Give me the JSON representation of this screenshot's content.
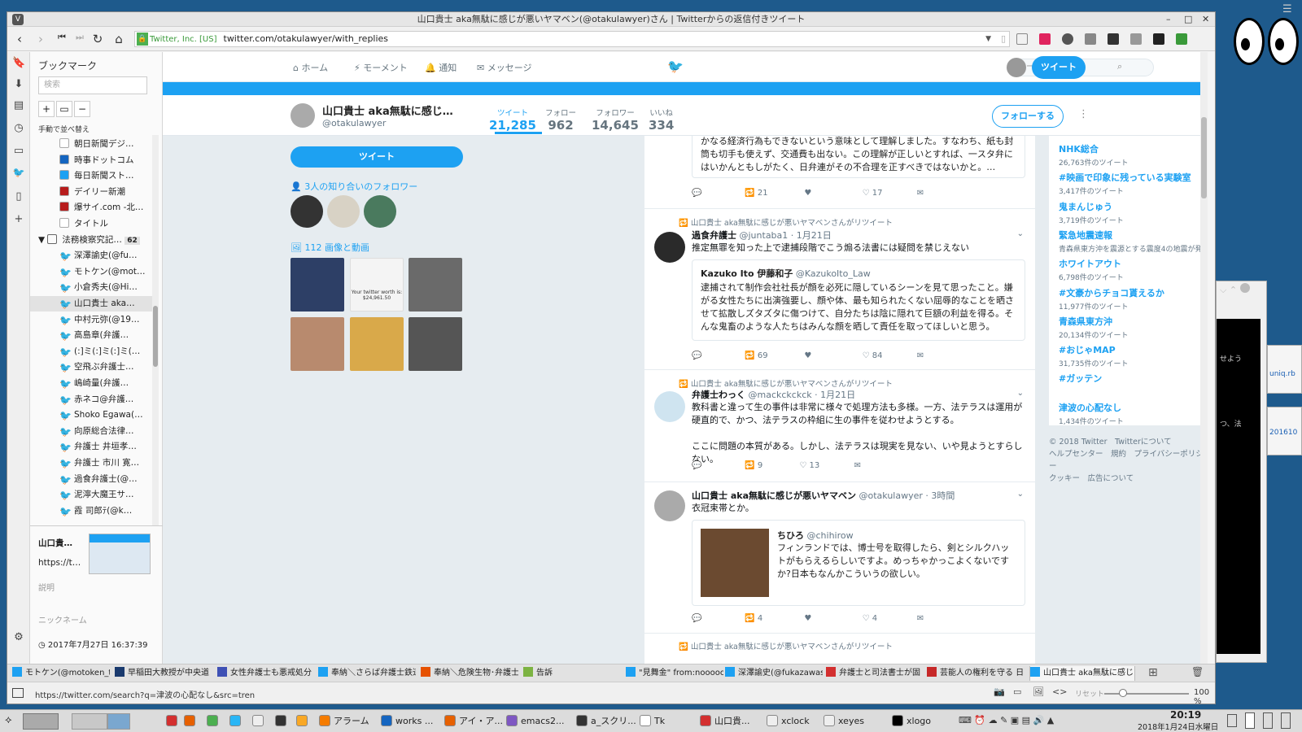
{
  "window": {
    "title": "山口貴士 aka無駄に感じが悪いヤマベン(@otakulawyer)さん | Twitterからの返信付きツイート"
  },
  "address": {
    "org": "Twitter, Inc. [US]",
    "url": "twitter.com/otakulawyer/with_replies"
  },
  "bookmarks": {
    "title": "ブックマーク",
    "search_placeholder": "検索",
    "sort_label": "手動で並べ替え",
    "items": [
      {
        "label": "朝日新聞デジ…",
        "icon": "page-icon"
      },
      {
        "label": "時事ドットコム",
        "icon": "globe-icon"
      },
      {
        "label": "毎日新聞スト…",
        "icon": "twitter-bird-icon"
      },
      {
        "label": "デイリー新潮",
        "icon": "site-icon"
      },
      {
        "label": "爆サイ.com -北…",
        "icon": "site-icon"
      },
      {
        "label": "タイトル",
        "icon": "page-icon"
      }
    ],
    "folder": {
      "label": "法務検察究記…",
      "count": "62"
    },
    "folder_items": [
      "深澤諭史(@fu…",
      "モトケン(@mot…",
      "小倉秀夫(@Hi…",
      "山口貴士 aka…",
      "中村元弥(@19…",
      "高島章(弁護…",
      "(:]ミ(:]ミ(:]ミ(…",
      "空飛ぶ弁護士…",
      "嶋崎量(弁護…",
      "赤ネコ@弁護…",
      "Shoko Egawa(…",
      "向原総合法律…",
      "弁護士 井垣孝…",
      "弁護士 市川 寛…",
      "過食弁護士(@…",
      "泥濘大魔王サ…",
      "霞 司郎ﾃ(@k…"
    ],
    "detail_title": "山口貴…",
    "detail_url": "https://t…",
    "detail_desc": "説明",
    "detail_nick": "ニックネーム",
    "detail_date": "2017年7月27日 16:37:39"
  },
  "twitter": {
    "nav": {
      "home": "ホーム",
      "moments": "モーメント",
      "notifications": "通知",
      "messages": "メッセージ"
    },
    "search_placeholder": "キーワード検索",
    "tweet_button": "ツイート",
    "profile": {
      "name": "山口貴士 aka無駄に感じ…",
      "handle": "@otakulawyer",
      "stats": [
        {
          "label": "ツイート",
          "value": "21,285"
        },
        {
          "label": "フォロー",
          "value": "962"
        },
        {
          "label": "フォロワー",
          "value": "14,645"
        },
        {
          "label": "いいね",
          "value": "334"
        }
      ],
      "follow_button": "フォローする",
      "known_followers": "3人の知り合いのフォロワー",
      "media_label": "112 画像と動画",
      "media_thumb_caption": "Your twitter worth is: $24,961.50"
    },
    "tweets": [
      {
        "text": "かなる経済行為もできないという意味として理解しました。すなわち、紙も封筒も切手も使えず、交通費も出ない。この理解が正しいとすれば、一スタ弁にはいかんともしがたく、日弁連がその不合理を正すべきではないかと。…",
        "replies": "",
        "retweets": "21",
        "likes": "17"
      },
      {
        "retweet_note": "山口貴士 aka無駄に感じが悪いヤマベンさんがリツイート",
        "name": "過食弁護士",
        "handle": "@juntaba1",
        "date": "· 1月21日",
        "text": "推定無罪を知った上で逮捕段階でこう煽る法書には疑問を禁じえない",
        "quote": {
          "name": "Kazuko Ito 伊藤和子",
          "handle": "@KazukoIto_Law",
          "text": "逮捕されて制作会社社長が顔を必死に隠しているシーンを見て思ったこと。嫌がる女性たちに出演強要し、顔や体、最も知られたくない屈辱的なことを晒させて拡散しズタズタに傷つけて、自分たちは陰に隠れて巨額の利益を得る。そんな鬼畜のような人たちはみんな顔を晒して責任を取ってほしいと思う。"
        },
        "retweets": "69",
        "likes": "84"
      },
      {
        "retweet_note": "山口貴士 aka無駄に感じが悪いヤマベンさんがリツイート",
        "name": "弁護士わっく",
        "handle": "@mackckckck",
        "date": "· 1月21日",
        "text": "教科書と違って生の事件は非常に様々で処理方法も多様。一方、法テラスは運用が硬直的で、かつ、法テラスの枠組に生の事件を従わせようとする。",
        "text2": "ここに問題の本質がある。しかし、法テラスは現実を見ない、いや見ようとすらしない。",
        "retweets": "9",
        "likes": "13"
      },
      {
        "name": "山口貴士 aka無駄に感じが悪いヤマベン",
        "handle": "@otakulawyer",
        "date": "· 3時間",
        "text": "衣冠束帯とか。",
        "quote": {
          "name": "ちひろ",
          "handle": "@chihirow",
          "text": "フィンランドでは、博士号を取得したら、剣とシルクハットがもらえるらしいですよ。めっちゃかっこよくないですか?日本もなんかこういうの欲しい。"
        },
        "retweets": "4",
        "likes": "4"
      },
      {
        "retweet_note": "山口貴士 aka無駄に感じが悪いヤマベンさんがリツイート"
      }
    ],
    "trends": [
      {
        "name": "NHK総合",
        "count": "26,763件のツイート"
      },
      {
        "name": "#映画で印象に残っている実験室",
        "count": "3,417件のツイート"
      },
      {
        "name": "鬼まんじゅう",
        "count": "3,719件のツイート"
      },
      {
        "name": "緊急地震速報",
        "count": "青森県東方沖を震源とする震度4の地震が発生"
      },
      {
        "name": "ホワイトアウト",
        "count": "6,798件のツイート"
      },
      {
        "name": "#文豪からチョコ貰えるか",
        "count": "11,977件のツイート"
      },
      {
        "name": "青森県東方沖",
        "count": "20,134件のツイート"
      },
      {
        "name": "#おじゃMAP",
        "count": "31,735件のツイート"
      },
      {
        "name": "#ガッテン",
        "count": ""
      },
      {
        "name": "津波の心配なし",
        "count": "1,434件のツイート"
      }
    ],
    "footer": [
      "© 2018 Twitter　Twitterについて",
      "ヘルプセンター　規約　プライバシーポリシー",
      "クッキー　広告について"
    ]
  },
  "tabs": [
    "モトケン(@motoken_tw",
    "早稲田大教授が中央道",
    "女性弁護士も悪戒処分",
    "奉納＼さらば弁護士鉄道",
    "奉納＼危険生物･弁護士",
    "告訴",
    "\"見舞金\" from:nooooo",
    "深澤諭史(@fukazawas)",
    "弁護士と司法書士が固",
    "芸能人の権利を守る 日",
    "山口貴士 aka無駄に感じ"
  ],
  "status": {
    "url": "https://twitter.com/search?q=津波の心配なし&src=tren",
    "reset": "リセット",
    "zoom": "100 %"
  },
  "taskbar": {
    "items": [
      "アラーム",
      "works ...",
      "アイ・ア...",
      "emacs2...",
      "a_スクリ...",
      "Tk",
      "山口貴...",
      "xclock",
      "xeyes",
      "xlogo"
    ],
    "time": "20:19",
    "date": "2018年1月24日水曜日"
  },
  "side_windows": {
    "text1": "せよう",
    "text2": "つ、法",
    "link1": "uniq.rb",
    "link2": "201610"
  }
}
